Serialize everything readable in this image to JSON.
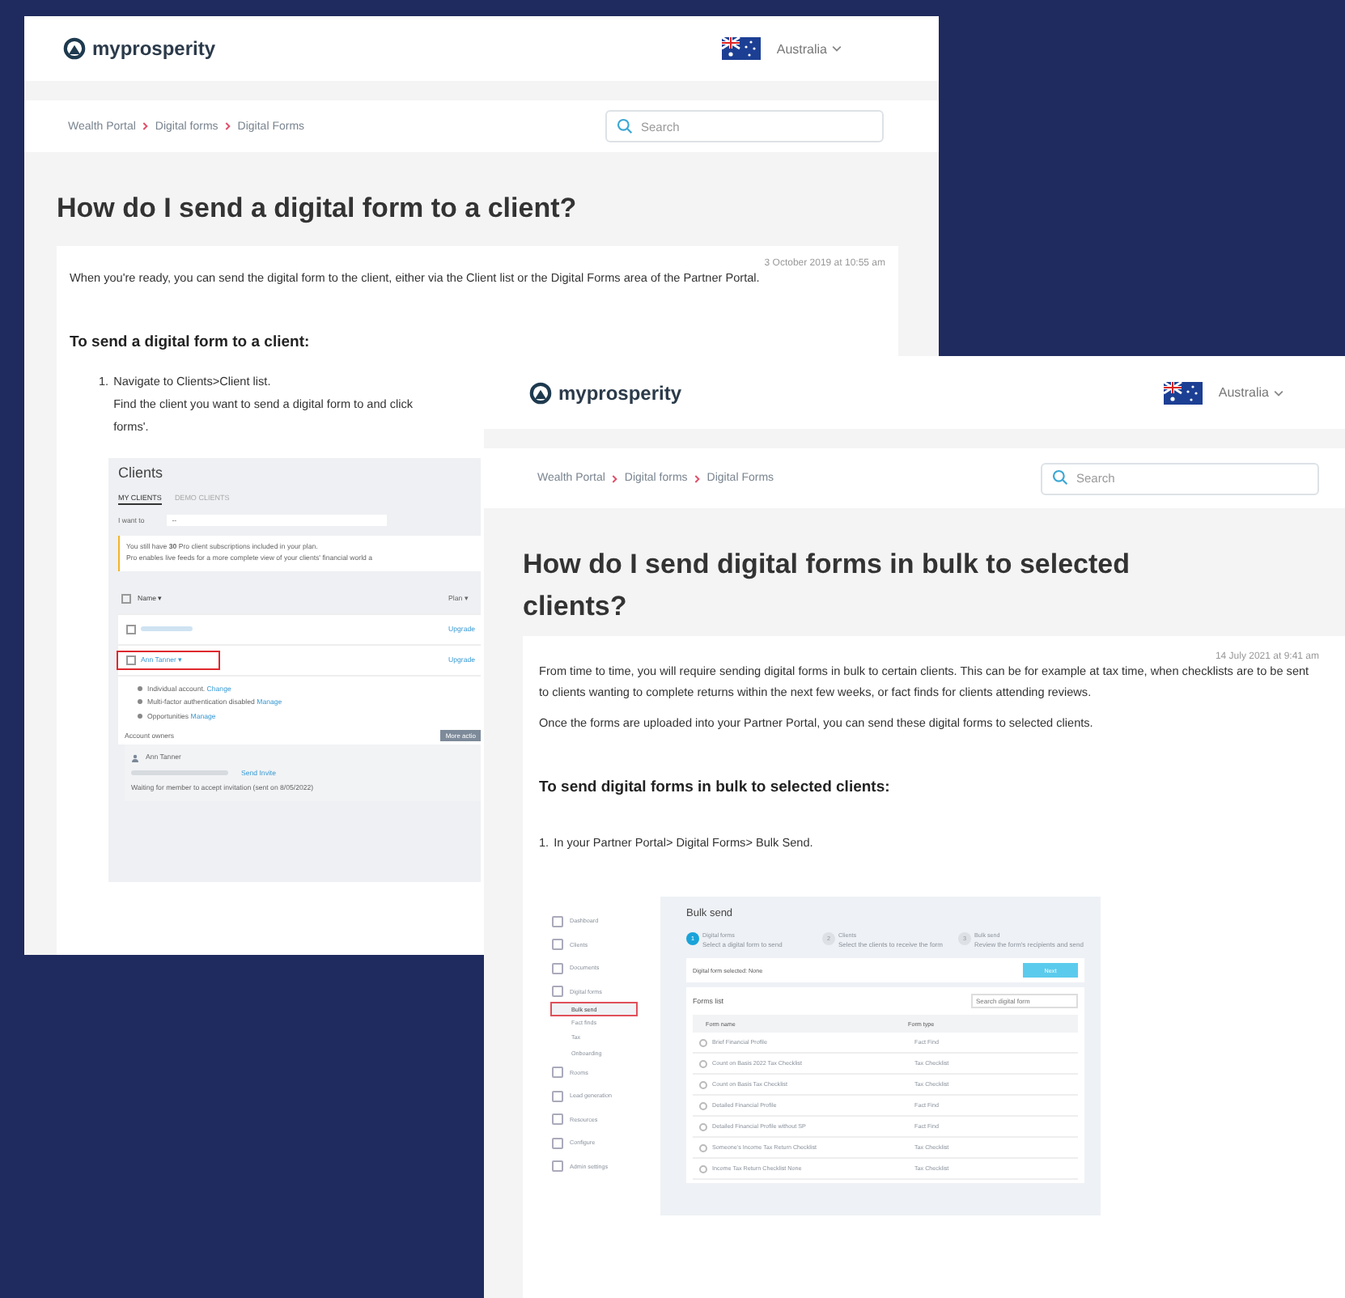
{
  "pages": [
    {
      "logo": "myprosperity",
      "country": "Australia",
      "breadcrumbs": [
        "Wealth Portal",
        "Digital forms",
        "Digital Forms"
      ],
      "search_placeholder": "Search",
      "title": "How do I send a digital form to a client?",
      "date": "3 October 2019 at 10:55 am",
      "paragraphs": [
        "When you're ready, you can send the digital form to the client, either via the Client list or the Digital Forms area of the Partner Portal."
      ],
      "subheading": "To send a digital form to a client:",
      "steps": [
        {
          "number": "1.",
          "lines": [
            "Navigate to Clients>Client list.",
            "Find the client you want to send a digital form to and click",
            "forms'."
          ]
        }
      ],
      "clients_screenshot": {
        "title": "Clients",
        "tabs": [
          {
            "label": "MY CLIENTS",
            "selected": true
          },
          {
            "label": "DEMO CLIENTS",
            "selected": false
          }
        ],
        "action_label": "I want to",
        "action_value": "--",
        "notice": [
          "You still have **30** Pro client subscriptions included in your plan.",
          "Pro enables live feeds for a more complete view of your clients' financial world a"
        ],
        "all_checked": false,
        "columns": [
          "Name ▾",
          "Plan ▾"
        ],
        "rows": [
          {
            "name": "",
            "plan": "Upgrade",
            "checked": false,
            "highlighted": false
          },
          {
            "name": "Ann Tanner ▾",
            "plan": "Upgrade",
            "checked": false,
            "highlighted": true
          }
        ],
        "details": [
          {
            "text": "Individual account.",
            "link": "Change"
          },
          {
            "text": "Multi-factor authentication disabled",
            "link": "Manage"
          },
          {
            "text": "Opportunities",
            "link": "Manage"
          }
        ],
        "owners_label": "Account owners",
        "more_button": "More actio",
        "owner_name": "Ann Tanner",
        "invite_link": "Send Invite",
        "waiting": "Waiting for member to accept invitation (sent on 8/05/2022)"
      }
    },
    {
      "logo": "myprosperity",
      "country": "Australia",
      "breadcrumbs": [
        "Wealth Portal",
        "Digital forms",
        "Digital Forms"
      ],
      "search_placeholder": "Search",
      "title": "How do I send digital forms in bulk to selected clients?",
      "date": "14 July 2021 at 9:41 am",
      "paragraphs": [
        "From time to time, you will require sending digital forms in bulk to certain clients. This can be for example at tax time, when checklists are to be sent to clients wanting to complete returns within the next few weeks, or fact finds for clients attending reviews.",
        "Once the forms are uploaded into your Partner Portal, you can send these digital forms to selected clients."
      ],
      "subheading": "To send digital forms in bulk to selected clients:",
      "steps": [
        {
          "number": "1.",
          "lines": [
            "In your Partner Portal> Digital Forms> Bulk Send."
          ]
        }
      ],
      "bulk_screenshot": {
        "sidebar": [
          {
            "label": "Dashboard",
            "sub": false,
            "highlighted": false
          },
          {
            "label": "Clients",
            "sub": false,
            "highlighted": false
          },
          {
            "label": "Documents",
            "sub": false,
            "highlighted": false
          },
          {
            "label": "Digital forms",
            "sub": false,
            "highlighted": false
          },
          {
            "label": "Bulk send",
            "sub": true,
            "highlighted": true
          },
          {
            "label": "Fact finds",
            "sub": true,
            "highlighted": false
          },
          {
            "label": "Tax",
            "sub": true,
            "highlighted": false
          },
          {
            "label": "Onboarding",
            "sub": true,
            "highlighted": false
          },
          {
            "label": "Rooms",
            "sub": false,
            "highlighted": false
          },
          {
            "label": "Lead generation",
            "sub": false,
            "highlighted": false
          },
          {
            "label": "Resources",
            "sub": false,
            "highlighted": false
          },
          {
            "label": "Configure",
            "sub": false,
            "highlighted": false
          },
          {
            "label": "Admin settings",
            "sub": false,
            "highlighted": false
          }
        ],
        "title": "Bulk send",
        "steps": [
          {
            "number": "1",
            "label": "Digital forms",
            "hint": "Select a digital form to send",
            "selected": true
          },
          {
            "number": "2",
            "label": "Clients",
            "hint": "Select the clients to receive the form",
            "selected": false
          },
          {
            "number": "3",
            "label": "Bulk send",
            "hint": "Review the form's recipients and send",
            "selected": false
          }
        ],
        "selected_label": "Digital form selected: None",
        "next_button": "Next",
        "list_title": "Forms list",
        "search_placeholder": "Search digital form",
        "columns": [
          "Form name",
          "Form type"
        ],
        "rows": [
          {
            "name": "Brief Financial Profile",
            "type": "Fact Find",
            "selected": false
          },
          {
            "name": "Count on Basis 2022 Tax Checklist",
            "type": "Tax Checklist",
            "selected": false
          },
          {
            "name": "Count on Basis Tax Checklist",
            "type": "Tax Checklist",
            "selected": false
          },
          {
            "name": "Detailed Financial Profile",
            "type": "Fact Find",
            "selected": false
          },
          {
            "name": "Detailed Financial Profile without SP",
            "type": "Fact Find",
            "selected": false
          },
          {
            "name": "Someone's Income Tax Return Checklist",
            "type": "Tax Checklist",
            "selected": false
          },
          {
            "name": "Income Tax Return Checklist None",
            "type": "Tax Checklist",
            "selected": false
          }
        ]
      }
    }
  ]
}
